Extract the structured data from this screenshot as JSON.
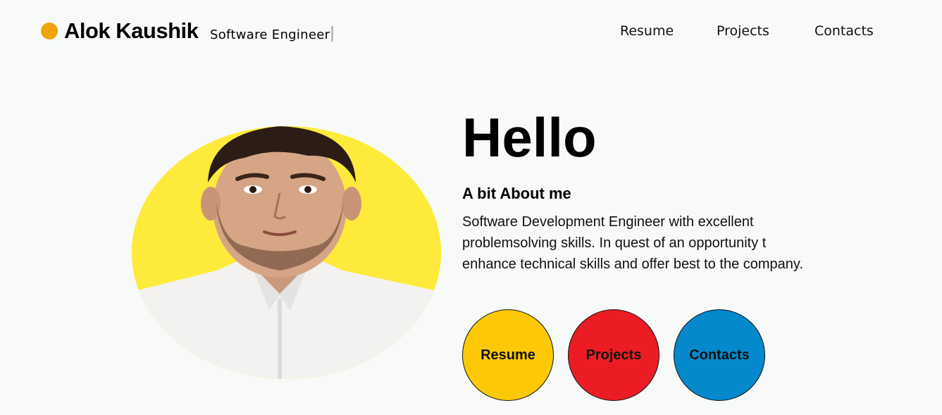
{
  "header": {
    "brand": "Alok Kaushik",
    "tagline": "Software Engineer",
    "logo_color": "#f0a30a"
  },
  "nav": {
    "items": [
      {
        "label": "Resume"
      },
      {
        "label": "Projects"
      },
      {
        "label": "Contacts"
      }
    ]
  },
  "hero": {
    "greeting": "Hello",
    "about_heading": "A bit About me",
    "about_text": "Software Development Engineer with excellent problemsolving skills. In quest of an opportunity t enhance technical skills and offer best to the company.",
    "photo_bg_color": "#fdea3a"
  },
  "buttons": [
    {
      "label": "Resume",
      "color": "#fdc906"
    },
    {
      "label": "Projects",
      "color": "#ec1c24"
    },
    {
      "label": "Contacts",
      "color": "#0389cc"
    }
  ]
}
